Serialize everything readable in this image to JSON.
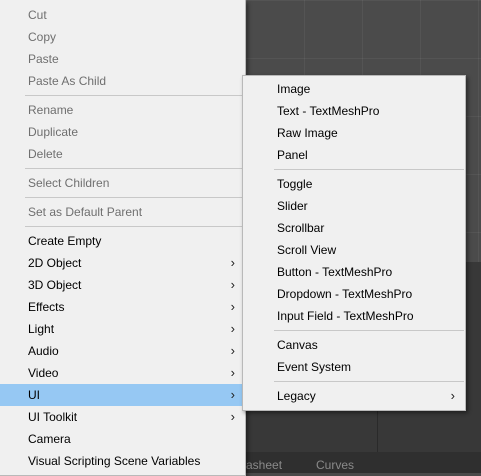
{
  "context_menu": {
    "items": [
      {
        "label": "Cut",
        "enabled": false
      },
      {
        "label": "Copy",
        "enabled": false
      },
      {
        "label": "Paste",
        "enabled": false
      },
      {
        "label": "Paste As Child",
        "enabled": false
      },
      {
        "label": "Rename",
        "enabled": false
      },
      {
        "label": "Duplicate",
        "enabled": false
      },
      {
        "label": "Delete",
        "enabled": false
      },
      {
        "label": "Select Children",
        "enabled": false
      },
      {
        "label": "Set as Default Parent",
        "enabled": false
      },
      {
        "label": "Create Empty",
        "enabled": true
      },
      {
        "label": "2D Object",
        "enabled": true,
        "submenu": true
      },
      {
        "label": "3D Object",
        "enabled": true,
        "submenu": true
      },
      {
        "label": "Effects",
        "enabled": true,
        "submenu": true
      },
      {
        "label": "Light",
        "enabled": true,
        "submenu": true
      },
      {
        "label": "Audio",
        "enabled": true,
        "submenu": true
      },
      {
        "label": "Video",
        "enabled": true,
        "submenu": true
      },
      {
        "label": "UI",
        "enabled": true,
        "submenu": true,
        "highlighted": true
      },
      {
        "label": "UI Toolkit",
        "enabled": true,
        "submenu": true
      },
      {
        "label": "Camera",
        "enabled": true
      },
      {
        "label": "Visual Scripting Scene Variables",
        "enabled": true
      }
    ]
  },
  "ui_submenu": {
    "items": [
      {
        "label": "Image"
      },
      {
        "label": "Text - TextMeshPro"
      },
      {
        "label": "Raw Image"
      },
      {
        "label": "Panel"
      },
      {
        "label": "Toggle"
      },
      {
        "label": "Slider"
      },
      {
        "label": "Scrollbar"
      },
      {
        "label": "Scroll View"
      },
      {
        "label": "Button - TextMeshPro"
      },
      {
        "label": "Dropdown - TextMeshPro"
      },
      {
        "label": "Input Field - TextMeshPro"
      },
      {
        "label": "Canvas"
      },
      {
        "label": "Event System"
      },
      {
        "label": "Legacy",
        "submenu": true
      }
    ]
  },
  "background": {
    "tabs": [
      {
        "label": "asheet"
      },
      {
        "label": "Curves"
      }
    ]
  },
  "icons": {
    "submenu_arrow": "chevron-right-icon"
  },
  "colors": {
    "menu_bg": "#f0f0f0",
    "highlight": "#96c8f3",
    "disabled_text": "#6f6f6f"
  }
}
